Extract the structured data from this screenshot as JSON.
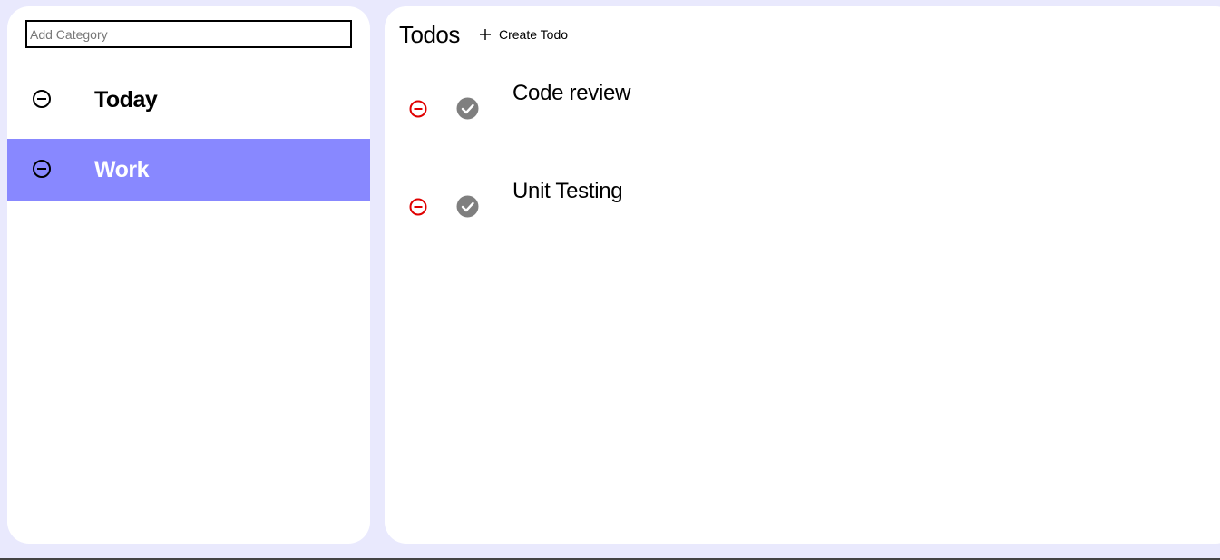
{
  "sidebar": {
    "add_category_placeholder": "Add Category",
    "categories": [
      {
        "label": "Today",
        "selected": false
      },
      {
        "label": "Work",
        "selected": true
      }
    ],
    "selected_color": "#8888ff"
  },
  "main": {
    "title": "Todos",
    "create_label": "Create Todo",
    "todos": [
      {
        "title": "Code review",
        "done": true
      },
      {
        "title": "Unit Testing",
        "done": true
      }
    ]
  },
  "colors": {
    "background": "#e9e9fd",
    "remove_todo": "#e00000",
    "check": "#7f7f7f"
  },
  "icons": {
    "category_remove": "minus-circle-icon",
    "todo_remove": "minus-circle-icon",
    "todo_check": "check-circle-icon",
    "create": "plus-icon"
  }
}
